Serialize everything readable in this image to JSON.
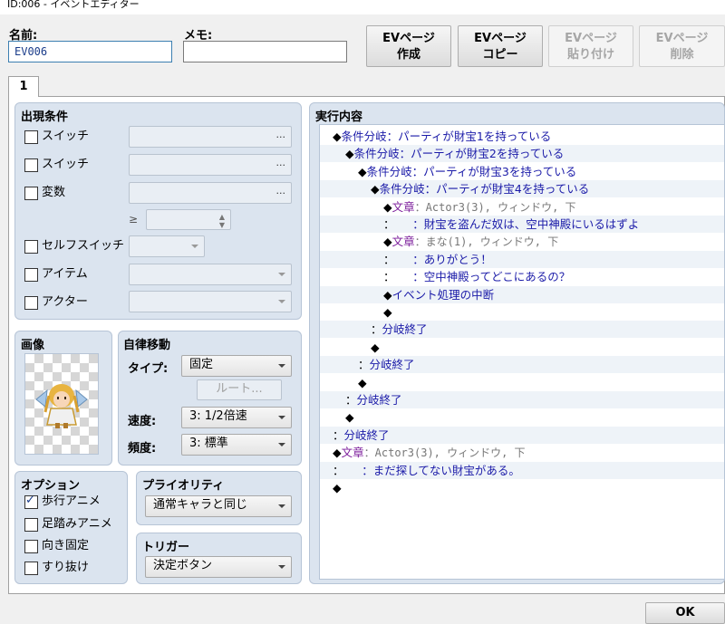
{
  "window": {
    "title": "ID:006 - イベントエディター"
  },
  "header": {
    "name_label": "名前:",
    "name_value": "EV006",
    "memo_label": "メモ:",
    "memo_value": "",
    "buttons": {
      "new_page": [
        "EVページ",
        "作成"
      ],
      "copy_page": [
        "EVページ",
        "コピー"
      ],
      "paste_page": [
        "EVページ",
        "貼り付け"
      ],
      "delete_page": [
        "EVページ",
        "削除"
      ]
    }
  },
  "tabs": [
    "1"
  ],
  "conditions": {
    "title": "出現条件",
    "switch1": "スイッチ",
    "switch2": "スイッチ",
    "variable": "変数",
    "compare": "≥",
    "self_switch": "セルフスイッチ",
    "item": "アイテム",
    "actor": "アクター",
    "ellipsis": "..."
  },
  "image": {
    "title": "画像"
  },
  "autonomous": {
    "title": "自律移動",
    "type_label": "タイプ:",
    "type_value": "固定",
    "route_button": "ルート...",
    "speed_label": "速度:",
    "speed_value": "3: 1/2倍速",
    "freq_label": "頻度:",
    "freq_value": "3: 標準"
  },
  "options": {
    "title": "オプション",
    "items": [
      {
        "label": "歩行アニメ",
        "checked": true
      },
      {
        "label": "足踏みアニメ",
        "checked": false
      },
      {
        "label": "向き固定",
        "checked": false
      },
      {
        "label": "すり抜け",
        "checked": false
      }
    ]
  },
  "priority": {
    "title": "プライオリティ",
    "value": "通常キャラと同じ"
  },
  "trigger": {
    "title": "トリガー",
    "value": "決定ボタン"
  },
  "contents": {
    "title": "実行内容",
    "lines": [
      {
        "d": "◆",
        "l": "条件分岐：パーティが財宝1を持っている"
      },
      {
        "d": "◆",
        "l": "条件分岐：パーティが財宝2を持っている"
      },
      {
        "d": "◆",
        "l": "条件分岐：パーティが財宝3を持っている"
      },
      {
        "d": "◆",
        "l": "条件分岐：パーティが財宝4を持っている"
      },
      {
        "d": "◆",
        "l": "文章",
        "g": "：Actor3(3), ウィンドウ, 下"
      },
      {
        "d": "：",
        "l": "：財宝を盗んだ奴は、空中神殿にいるはずよ"
      },
      {
        "d": "◆",
        "l": "文章",
        "g": "：まな(1), ウィンドウ, 下"
      },
      {
        "d": "：",
        "l": "：ありがとう！"
      },
      {
        "d": "：",
        "l": "：空中神殿ってどこにあるの？"
      },
      {
        "d": "◆",
        "l": "イベント処理の中断"
      },
      {
        "d": "◆",
        "l": ""
      },
      {
        "d": "：",
        "l": "分岐終了"
      },
      {
        "d": "◆",
        "l": ""
      },
      {
        "d": "：",
        "l": "分岐終了"
      },
      {
        "d": "◆",
        "l": ""
      },
      {
        "d": "：",
        "l": "分岐終了"
      },
      {
        "d": "◆",
        "l": ""
      },
      {
        "d": "：",
        "l": "分岐終了"
      },
      {
        "d": "◆",
        "l": "文章",
        "g": "：Actor3(3), ウィンドウ, 下"
      },
      {
        "d": "：",
        "l": "：まだ探してない財宝がある。"
      },
      {
        "d": "◆",
        "l": ""
      }
    ]
  },
  "footer": {
    "ok": "OK"
  }
}
